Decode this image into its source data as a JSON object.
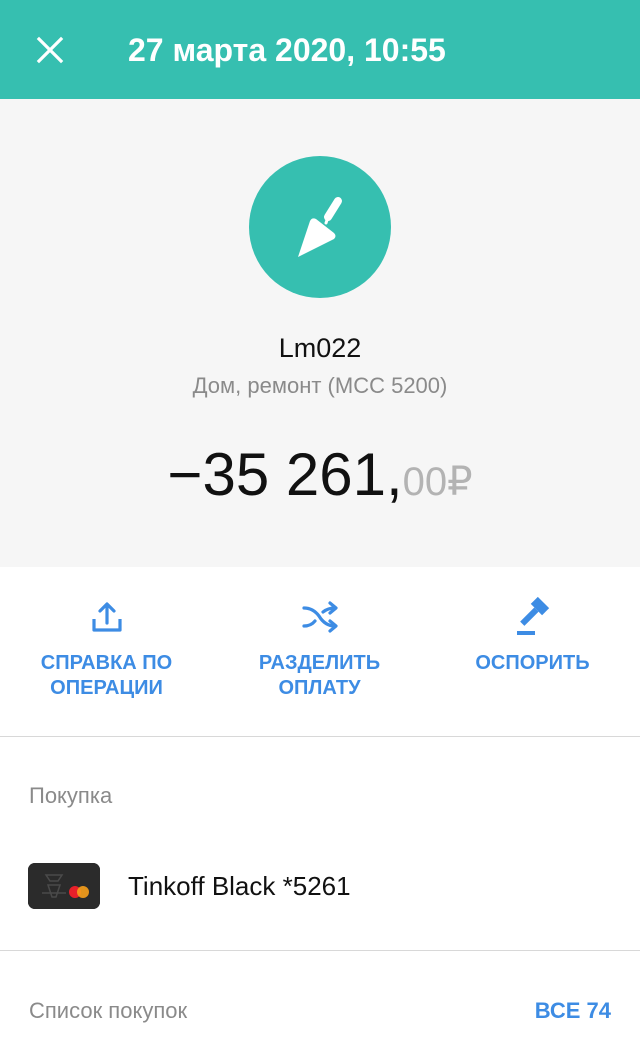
{
  "header": {
    "title": "27 марта 2020, 10:55",
    "close_icon": "close-icon"
  },
  "merchant": {
    "icon": "trowel-icon",
    "name": "Lm022",
    "category": "Дом, ремонт (MCC 5200)"
  },
  "amount": {
    "main": "−35 261,",
    "fraction": "00",
    "currency": "₽"
  },
  "actions": [
    {
      "icon": "share-icon",
      "label": "СПРАВКА ПО\nОПЕРАЦИИ"
    },
    {
      "icon": "shuffle-icon",
      "label": "РАЗДЕЛИТЬ\nОПЛАТУ"
    },
    {
      "icon": "gavel-icon",
      "label": "ОСПОРИТЬ"
    }
  ],
  "purchase": {
    "section_label": "Покупка",
    "card_name": "Tinkoff Black *5261"
  },
  "purchases_list": {
    "label": "Список покупок",
    "all_link": "ВСЕ 74"
  },
  "colors": {
    "accent": "#36bfb0",
    "link": "#3d8ce4",
    "muted": "#8a8a8a"
  }
}
